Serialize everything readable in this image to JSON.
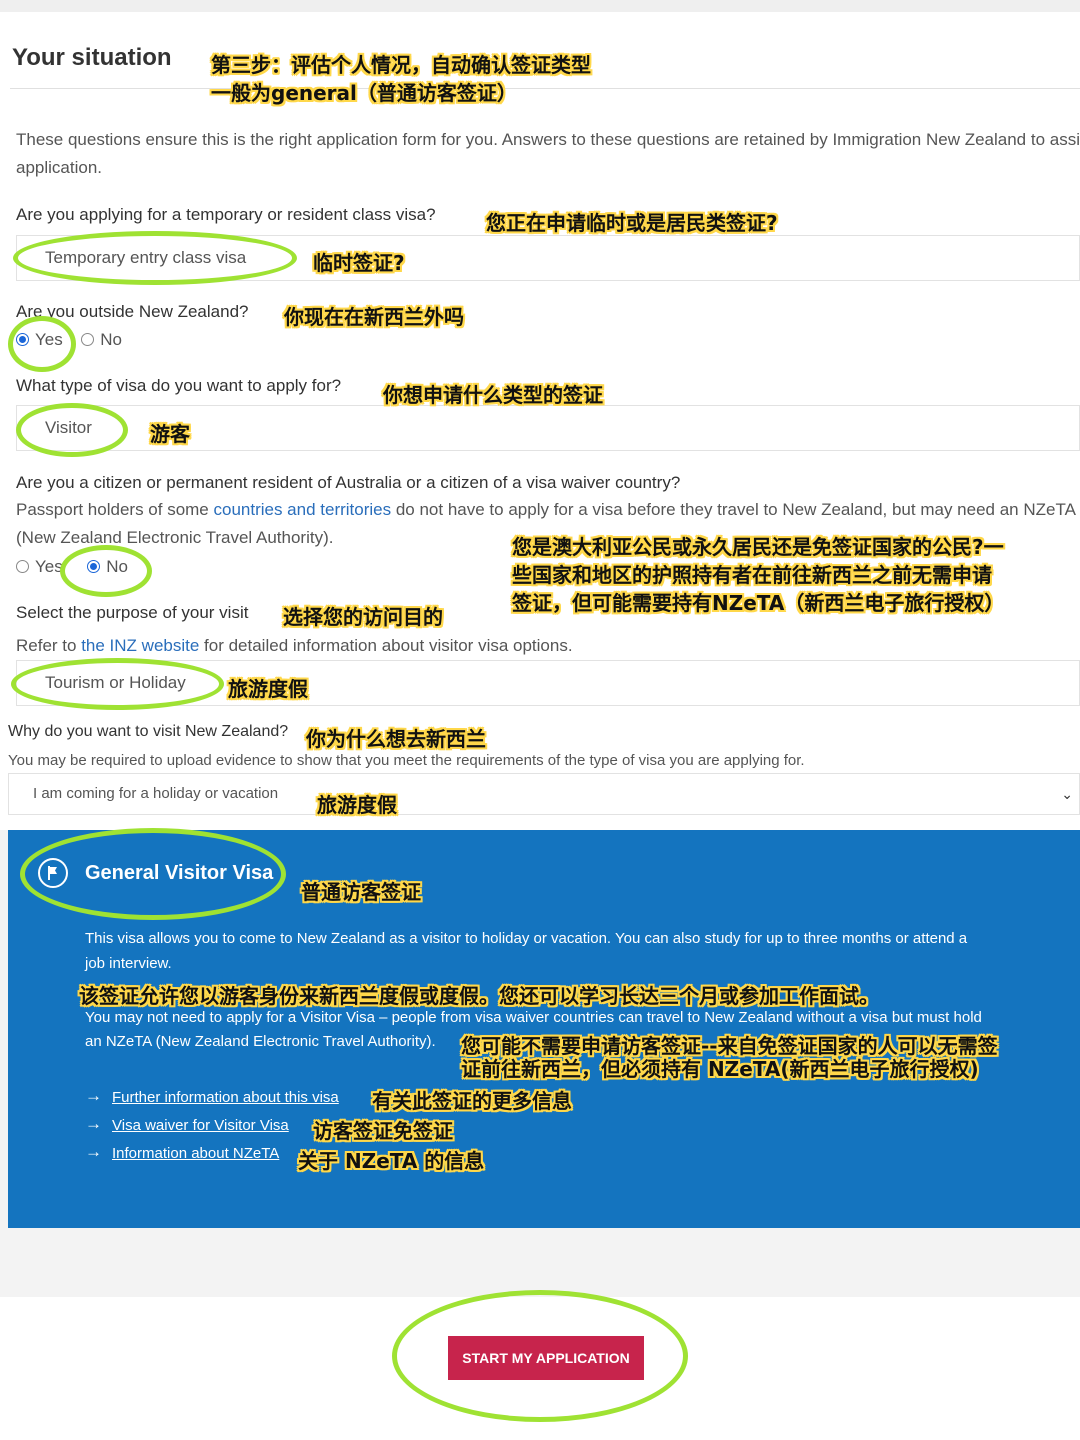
{
  "page": {
    "title": "Your situation",
    "intro": "These questions ensure this is the right application form for you. Answers to these questions are retained by Immigration New Zealand to assist with your",
    "intro2": "application."
  },
  "q1": {
    "label": "Are you applying for a temporary or resident class visa?",
    "value": "Temporary entry class visa"
  },
  "q2": {
    "label": "Are you outside New Zealand?",
    "options": [
      "Yes",
      "No"
    ],
    "selected": "Yes"
  },
  "q3": {
    "label": "What type of visa do you want to apply for?",
    "value": "Visitor"
  },
  "q4": {
    "label": "Are you a citizen or permanent resident of Australia or a citizen of a visa waiver country?",
    "desc_before": "Passport holders of some ",
    "desc_link": "countries and territories",
    "desc_after": " do not have to apply for a visa before they travel to New Zealand, but may need an NZeTA",
    "desc2": "(New Zealand Electronic Travel Authority).",
    "options": [
      "Yes",
      "No"
    ],
    "selected": "No"
  },
  "q5": {
    "label": "Select the purpose of your visit",
    "ref_before": "Refer to ",
    "ref_link": "the INZ website",
    "ref_after": " for detailed information about visitor visa options.",
    "value": "Tourism or Holiday"
  },
  "q6": {
    "label": "Why do you want to visit New Zealand?",
    "desc": "You may be required to upload evidence to show that you meet the requirements of the type of visa you are applying for.",
    "value": "I am coming for a holiday or vacation"
  },
  "result": {
    "title": "General Visitor Visa",
    "desc1": "This visa allows you to come to New Zealand as a visitor to holiday or vacation. You can also study for up to three months or attend a",
    "desc1b": "job interview.",
    "desc2": "You may not need to apply for a Visitor Visa – people from visa waiver countries can travel to New Zealand without a visa but must hold",
    "desc2b": "an NZeTA (New Zealand Electronic Travel Authority).",
    "links": [
      "Further information about this visa",
      "Visa waiver for Visitor Visa",
      "Information about NZeTA"
    ]
  },
  "start_button": "START MY APPLICATION",
  "annotations": {
    "step": "第三步：评估个人情况，自动确认签证类型",
    "step2": "一般为general（普通访客签证）",
    "q1": "您正在申请临时或是居民类签证?",
    "q1_ans": "临时签证?",
    "q2": "你现在在新西兰外吗",
    "q3": "你想申请什么类型的签证",
    "q3_ans": "游客",
    "q4_l1": "您是澳大利亚公民或永久居民还是免签证国家的公民?一",
    "q4_l2": "些国家和地区的护照持有者在前往新西兰之前无需申请",
    "q4_l3": "签证，但可能需要持有NZeTA（新西兰电子旅行授权）",
    "q5": "选择您的访问目的",
    "q5_ans": "旅游度假",
    "q6": "你为什么想去新西兰",
    "q6_ans": "旅游度假",
    "visa": "普通访客签证",
    "desc1": "该签证允许您以游客身份来新西兰度假或度假。您还可以学习长达三个月或参加工作面试。",
    "desc2_l1": "您可能不需要申请访客签证--来自免签证国家的人可以无需签",
    "desc2_l2": "证前往新西兰，但必须持有 NZeTA(新西兰电子旅行授权)",
    "link1": "有关此签证的更多信息",
    "link2": "访客签证免签证",
    "link3": "关于 NZeTA 的信息"
  }
}
